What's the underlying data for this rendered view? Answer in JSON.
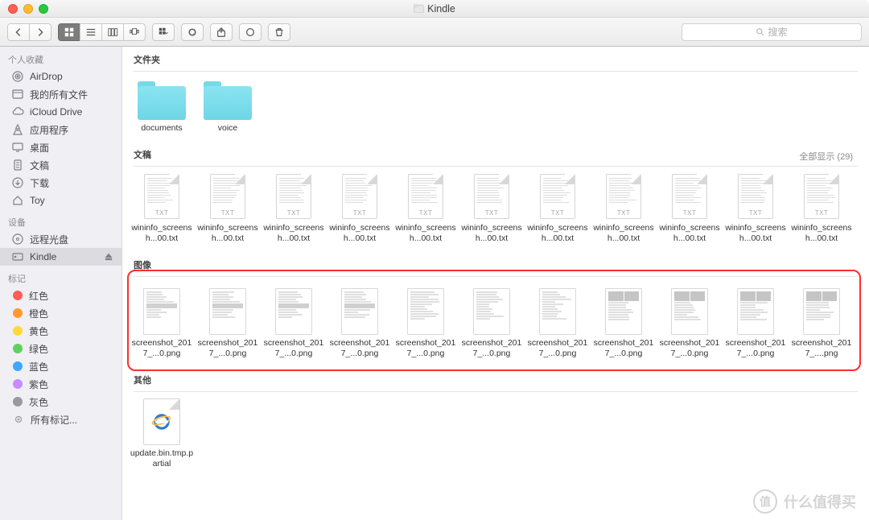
{
  "window": {
    "title": "Kindle"
  },
  "search": {
    "placeholder": "搜索"
  },
  "sidebar": {
    "favorites_label": "个人收藏",
    "devices_label": "设备",
    "tags_label": "标记",
    "favorites": [
      {
        "label": "AirDrop",
        "icon": "airdrop"
      },
      {
        "label": "我的所有文件",
        "icon": "allfiles"
      },
      {
        "label": "iCloud Drive",
        "icon": "icloud"
      },
      {
        "label": "应用程序",
        "icon": "apps"
      },
      {
        "label": "桌面",
        "icon": "desktop"
      },
      {
        "label": "文稿",
        "icon": "documents"
      },
      {
        "label": "下载",
        "icon": "downloads"
      },
      {
        "label": "Toy",
        "icon": "home"
      }
    ],
    "devices": [
      {
        "label": "远程光盘",
        "icon": "disc"
      },
      {
        "label": "Kindle",
        "icon": "ext",
        "selected": true,
        "eject": true
      }
    ],
    "tags": [
      {
        "label": "红色",
        "color": "#ff5d55"
      },
      {
        "label": "橙色",
        "color": "#ff9a2f"
      },
      {
        "label": "黄色",
        "color": "#ffd93a"
      },
      {
        "label": "绿色",
        "color": "#5ed060"
      },
      {
        "label": "蓝色",
        "color": "#3ea7ff"
      },
      {
        "label": "紫色",
        "color": "#c98cff"
      },
      {
        "label": "灰色",
        "color": "#9a9a9a"
      }
    ],
    "all_tags_label": "所有标记..."
  },
  "sections": {
    "folders": {
      "title": "文件夹",
      "items": [
        {
          "name": "documents"
        },
        {
          "name": "voice"
        }
      ]
    },
    "docs": {
      "title": "文稿",
      "show_all": "全部显示 (29)",
      "items": [
        {
          "name": "wininfo_screensh...00.txt"
        },
        {
          "name": "wininfo_screensh...00.txt"
        },
        {
          "name": "wininfo_screensh...00.txt"
        },
        {
          "name": "wininfo_screensh...00.txt"
        },
        {
          "name": "wininfo_screensh...00.txt"
        },
        {
          "name": "wininfo_screensh...00.txt"
        },
        {
          "name": "wininfo_screensh...00.txt"
        },
        {
          "name": "wininfo_screensh...00.txt"
        },
        {
          "name": "wininfo_screensh...00.txt"
        },
        {
          "name": "wininfo_screensh...00.txt"
        },
        {
          "name": "wininfo_screensh...00.txt"
        }
      ]
    },
    "images": {
      "title": "图像",
      "items": [
        {
          "name": "screenshot_2017_...0.png"
        },
        {
          "name": "screenshot_2017_...0.png"
        },
        {
          "name": "screenshot_2017_...0.png"
        },
        {
          "name": "screenshot_2017_...0.png"
        },
        {
          "name": "screenshot_2017_...0.png"
        },
        {
          "name": "screenshot_2017_...0.png"
        },
        {
          "name": "screenshot_2017_...0.png"
        },
        {
          "name": "screenshot_2017_...0.png"
        },
        {
          "name": "screenshot_2017_...0.png"
        },
        {
          "name": "screenshot_2017_...0.png"
        },
        {
          "name": "screenshot_2017_....png"
        }
      ]
    },
    "other": {
      "title": "其他",
      "items": [
        {
          "name": "update.bin.tmp.partial"
        }
      ]
    }
  },
  "watermark": {
    "logo": "值",
    "text": "什么值得买"
  }
}
